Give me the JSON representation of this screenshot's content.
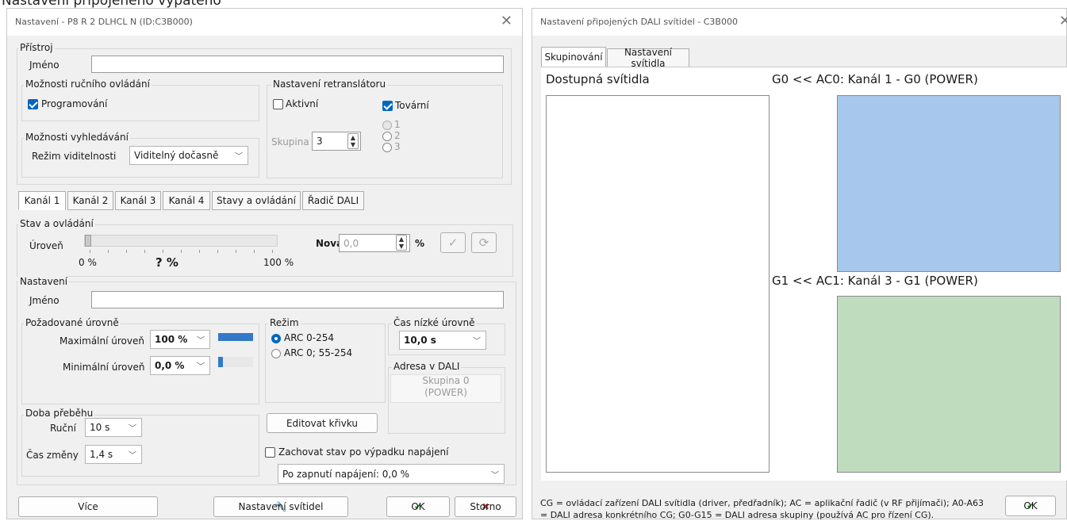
{
  "header_caption": "Nastavení přípojeného výpaťěho",
  "left_window": {
    "title": "Nastavení - P8 R 2 DLHCL N (ID:C3B000)",
    "device_group": "Přístroj",
    "name_label": "Jméno",
    "name_value": "",
    "manual_group": "Možnosti ručního ovládání",
    "programming_label": "Programování",
    "search_group": "Možnosti vyhledávání",
    "visibility_label": "Režim viditelnosti",
    "visibility_value": "Viditelný dočasně",
    "repeater_group": "Nastavení retranslátoru",
    "active_label": "Aktivní",
    "factory_label": "Tovární",
    "group_label": "Skupina",
    "group_value": "3",
    "radio_options": [
      "1",
      "2",
      "3"
    ],
    "tabs": [
      "Kanál 1",
      "Kanál 2",
      "Kanál 3",
      "Kanál 4",
      "Stavy a ovládání",
      "Řadič DALI"
    ],
    "state_group": "Stav a ovládání",
    "level_label": "Úroveň",
    "new_label": "Nová",
    "new_value": "0,0",
    "percent_sign": "%",
    "scale_min": "0 %",
    "scale_current": "? %",
    "scale_max": "100 %",
    "level_value_percent": 0,
    "settings_group": "Nastavení",
    "settings_name_label": "Jméno",
    "settings_name_value": "",
    "required_levels_group": "Požadované úrovně",
    "max_level_label": "Maximální úroveň",
    "max_level_value": "100 %",
    "max_level_percent": 100,
    "min_level_label": "Minimální úroveň",
    "min_level_value": "0,0 %",
    "min_level_percent": 0,
    "mode_group": "Režim",
    "mode_options": [
      "ARC 0-254",
      "ARC 0; 55-254"
    ],
    "low_time_group": "Čas nízké úrovně",
    "low_time_value": "10,0 s",
    "dali_address_group": "Adresa v DALI",
    "dali_address_line1": "Skupina 0",
    "dali_address_line2": "(POWER)",
    "transition_group": "Doba přeběhu",
    "manual_label": "Ruční",
    "manual_value": "10 s",
    "change_time_label": "Čas změny",
    "change_time_value": "1,4 s",
    "edit_curve_button": "Editovat křivku",
    "keep_state_label": "Zachovat stav po výpadku napájení",
    "power_on_value": "Po zapnutí napájení: 0,0 %",
    "more_button": "Více",
    "luminaires_button": "Nastavení svítidel",
    "ok_button": "OK",
    "cancel_button": "Storno"
  },
  "right_window": {
    "title": "Nastavení připojených DALI svítidel - C3B000",
    "tabs": [
      "Skupinování",
      "Nastavení svítidla"
    ],
    "available_label": "Dostupná svítidla",
    "groups": [
      {
        "label": "G0 << AC0: Kanál 1 - G0 (POWER)",
        "color": "#a7c8ec"
      },
      {
        "label": "G1 << AC1: Kanál 3 - G1 (POWER)",
        "color": "#c0dcbf"
      }
    ],
    "footer_line1": "CG = ovládací zařízení DALI svítidla (driver, předřadník); AC = aplikační řadič (v RF přijímači); A0-A63",
    "footer_line2": "= DALI adresa konkrétního CG; G0-G15 = DALI adresa skupiny (používá AC pro řízení CG).",
    "ok_button": "OK"
  },
  "colors": {
    "accent": "#0067c0",
    "ok_check": "#1b8a1b",
    "cancel_x": "#d0282d"
  }
}
